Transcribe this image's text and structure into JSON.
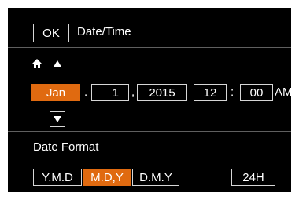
{
  "header": {
    "ok_label": "OK",
    "title": "Date/Time"
  },
  "date_time": {
    "month": "Jan",
    "day": "1",
    "year": "2015",
    "hour": "12",
    "minute": "00",
    "ampm": "AM",
    "separator_dot": ".",
    "separator_comma": ",",
    "separator_colon": ":",
    "selected_field": "month"
  },
  "icons": {
    "home": "home-icon",
    "up": "up-arrow-icon",
    "down": "down-arrow-icon"
  },
  "date_format": {
    "label": "Date Format",
    "options": [
      "Y.M.D",
      "M.D,Y",
      "D.M.Y"
    ],
    "selected": "M.D,Y",
    "clock_label": "24H"
  },
  "colors": {
    "background": "#000000",
    "accent": "#e06a10",
    "text": "#ffffff",
    "divider": "#5f5f5f"
  }
}
